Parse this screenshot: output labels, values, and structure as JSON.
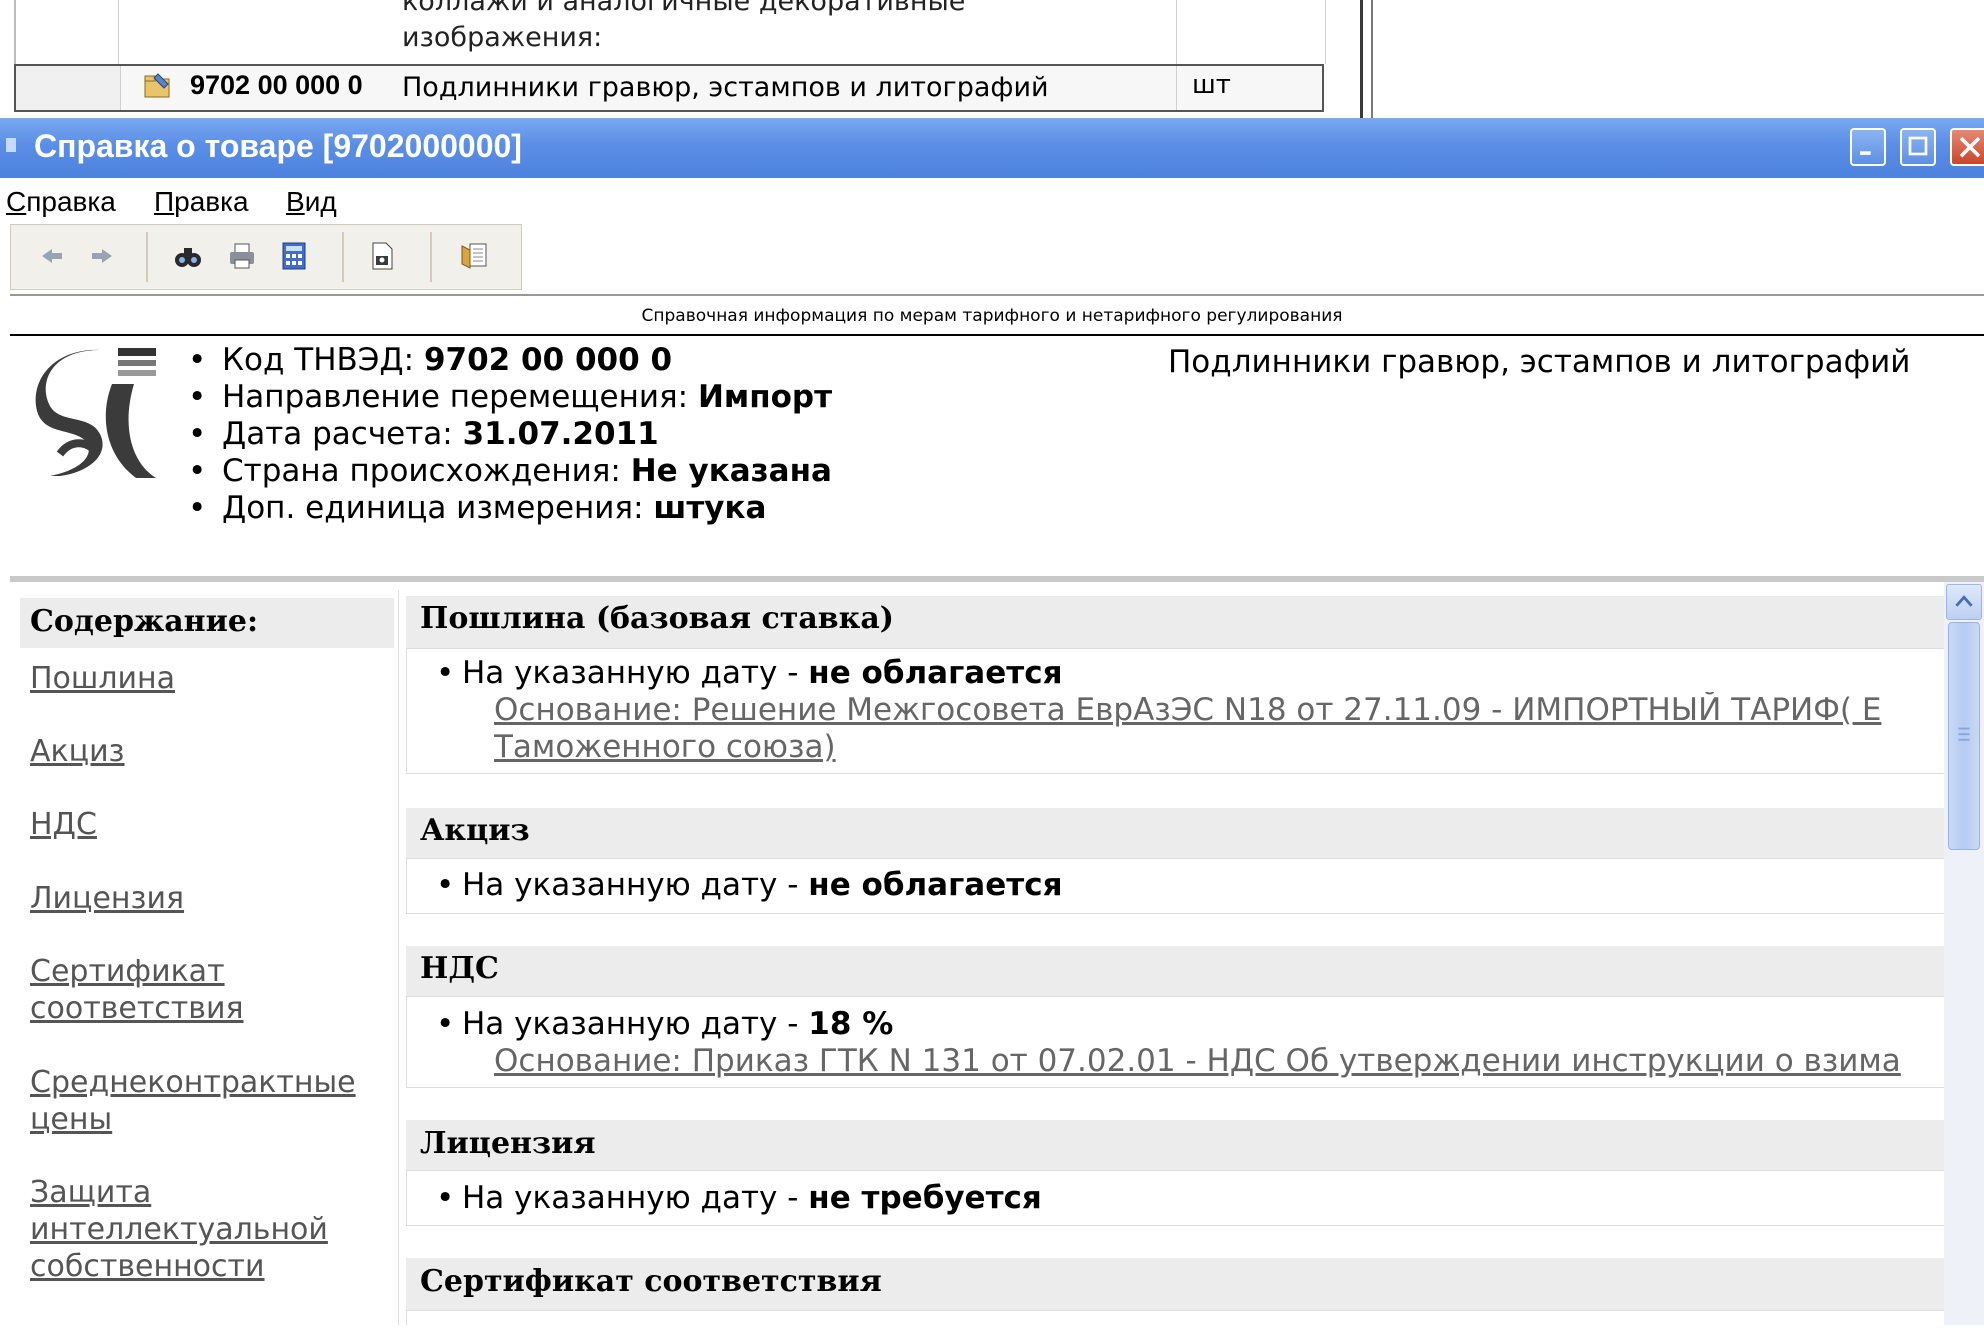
{
  "bg_table": {
    "cut_text": "коллажи и аналогичные декоративные",
    "desc_line2": "изображения:",
    "code": "9702 00 000 0",
    "name": "Подлинники гравюр, эстампов и литографий",
    "unit": "шт"
  },
  "window": {
    "title": "Справка о товаре [9702000000]"
  },
  "menu": {
    "items": [
      {
        "label": "Справка",
        "accel": "С",
        "rest": "правка"
      },
      {
        "label": "Правка",
        "accel": "П",
        "rest": "равка"
      },
      {
        "label": "Вид",
        "accel": "В",
        "rest": "ид"
      }
    ]
  },
  "toolbar": {
    "icons": [
      "back-arrow-icon",
      "forward-arrow-icon",
      "find-icon",
      "print-icon",
      "calculator-icon",
      "document-icon",
      "export-icon"
    ]
  },
  "ref_title": "Справочная информация по мерам тарифного и нетарифного регулирования",
  "info": {
    "items": [
      {
        "label": "Код ТНВЭД:",
        "value": "9702 00 000 0"
      },
      {
        "label": "Направление перемещения:",
        "value": "Импорт"
      },
      {
        "label": "Дата расчета:",
        "value": "31.07.2011"
      },
      {
        "label": "Страна происхождения:",
        "value": "Не указана"
      },
      {
        "label": "Доп. единица измерения:",
        "value": "штука"
      }
    ],
    "product_name": "Подлинники гравюр, эстампов и литографий"
  },
  "toc": {
    "title": "Содержание:",
    "links": [
      [
        "Пошлина"
      ],
      [
        "Акциз"
      ],
      [
        "НДС"
      ],
      [
        "Лицензия"
      ],
      [
        "Сертификат",
        "соответствия"
      ],
      [
        "Среднеконтрактные",
        "цены"
      ],
      [
        "Защита",
        "интеллектуальной",
        "собственности"
      ]
    ]
  },
  "sections": {
    "duty": {
      "title": "Пошлина (базовая ставка)",
      "prefix": "На указанную дату - ",
      "value": "не облагается",
      "basis1": "Основание: Решение Межгосовета ЕврАзЭС N18 от 27.11.09 - ИМПОРТНЫЙ ТАРИФ( Е",
      "basis2": "Таможенного союза)"
    },
    "excise": {
      "title": "Акциз",
      "prefix": "На указанную дату - ",
      "value": "не облагается"
    },
    "vat": {
      "title": "НДС",
      "prefix": "На указанную дату - ",
      "value": "18 %",
      "basis1": "Основание: Приказ ГТК N 131 от 07.02.01 - НДС Об утверждении инструкции о взима"
    },
    "license": {
      "title": "Лицензия",
      "prefix": "На указанную дату - ",
      "value": "не требуется"
    },
    "cert": {
      "title": "Сертификат соответствия"
    }
  },
  "colors": {
    "titlebar": "#5a8ee6",
    "section_header": "#ececec",
    "link": "#555555"
  }
}
